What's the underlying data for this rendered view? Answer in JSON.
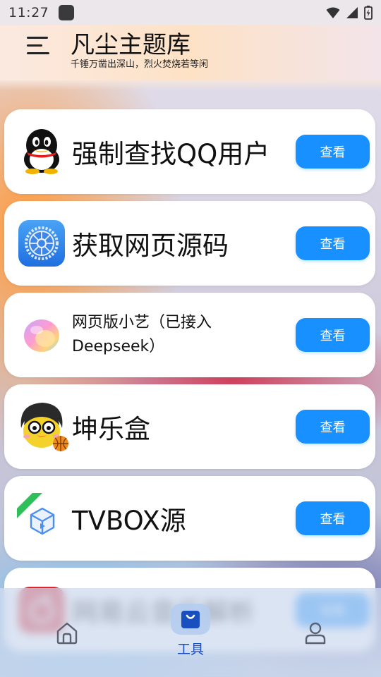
{
  "status_bar": {
    "time": "11:27"
  },
  "header": {
    "title": "凡尘主题库",
    "subtitle": "千锤万凿出深山，烈火焚烧若等闲"
  },
  "cards": [
    {
      "title": "强制查找QQ用户",
      "icon": "qq-penguin-icon",
      "button": "查看"
    },
    {
      "title": "获取网页源码",
      "icon": "settings-gear-icon",
      "button": "查看"
    },
    {
      "title": "网页版小艺（已接入Deepseek）",
      "icon": "xiaoyi-orb-icon",
      "button": "查看"
    },
    {
      "title": "坤乐盒",
      "icon": "cartoon-avatar-icon",
      "button": "查看"
    },
    {
      "title": "TVBOX源",
      "icon": "tvbox-cube-icon",
      "button": "查看"
    },
    {
      "title": "网易云音乐解析",
      "icon": "netease-music-icon",
      "button": "查看"
    }
  ],
  "bottom_nav": {
    "items": [
      {
        "label": "",
        "icon": "home-icon"
      },
      {
        "label": "工具",
        "icon": "tools-bag-icon",
        "active": true
      },
      {
        "label": "",
        "icon": "profile-icon"
      }
    ]
  },
  "colors": {
    "accent": "#1890ff",
    "nav_active": "#1a4fbf",
    "card_bg": "#ffffff"
  }
}
